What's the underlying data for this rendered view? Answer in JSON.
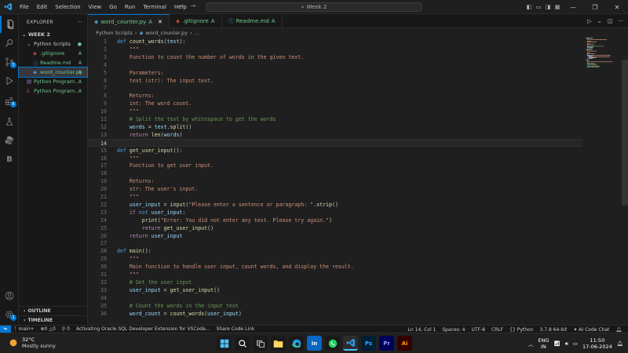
{
  "menu": [
    "File",
    "Edit",
    "Selection",
    "View",
    "Go",
    "Run",
    "Terminal",
    "Help"
  ],
  "search": {
    "text": "Week 2"
  },
  "explorer": {
    "header": "EXPLORER",
    "workspace": "WEEK 2",
    "items": [
      {
        "name": "Python Scripts",
        "status": "",
        "indent": 1,
        "kind": "folder"
      },
      {
        "name": ".gitignore",
        "status": "A",
        "indent": 2,
        "kind": "git"
      },
      {
        "name": "Readme.md",
        "status": "A",
        "indent": 2,
        "kind": "md"
      },
      {
        "name": "word_counter.py",
        "status": "A",
        "indent": 2,
        "kind": "py",
        "selected": true
      },
      {
        "name": "Python Program...",
        "status": "A",
        "indent": 1,
        "kind": "pdf"
      },
      {
        "name": "Python Program...",
        "status": "A",
        "indent": 1,
        "kind": "pdfr"
      }
    ],
    "outline": "OUTLINE",
    "timeline": "TIMELINE"
  },
  "tabs": [
    {
      "label": "word_counter.py",
      "status": "A",
      "active": true
    },
    {
      "label": ".gitignore",
      "status": "A",
      "active": false
    },
    {
      "label": "Readme.md",
      "status": "A",
      "active": false
    }
  ],
  "breadcrumb": {
    "folder": "Python Scripts",
    "file": "word_counter.py",
    "more": "..."
  },
  "code": [
    [
      [
        "kw",
        "def "
      ],
      [
        "fn",
        "count_words"
      ],
      [
        "code",
        "("
      ],
      [
        "var",
        "text"
      ],
      [
        "code",
        "):"
      ]
    ],
    [
      [
        "doc",
        "    \"\"\""
      ]
    ],
    [
      [
        "doc",
        "    Function to count the number of words in the given text."
      ]
    ],
    [
      [
        "doc",
        ""
      ]
    ],
    [
      [
        "doc",
        "    Parameters:"
      ]
    ],
    [
      [
        "doc",
        "    text (str): The input text."
      ]
    ],
    [
      [
        "doc",
        ""
      ]
    ],
    [
      [
        "doc",
        "    Returns:"
      ]
    ],
    [
      [
        "doc",
        "    int: The word count."
      ]
    ],
    [
      [
        "doc",
        "    \"\"\""
      ]
    ],
    [
      [
        "cm",
        "    # Split the text by whitespace to get the words"
      ]
    ],
    [
      [
        "var",
        "    words"
      ],
      [
        "code",
        " = "
      ],
      [
        "var",
        "text"
      ],
      [
        "code",
        "."
      ],
      [
        "fn",
        "split"
      ],
      [
        "code",
        "()"
      ]
    ],
    [
      [
        "kwf",
        "    return "
      ],
      [
        "bi",
        "len"
      ],
      [
        "code",
        "("
      ],
      [
        "var",
        "words"
      ],
      [
        "code",
        ")"
      ]
    ],
    [
      [
        "code",
        ""
      ]
    ],
    [
      [
        "kw",
        "def "
      ],
      [
        "fn",
        "get_user_input"
      ],
      [
        "code",
        "():"
      ]
    ],
    [
      [
        "doc",
        "    \"\"\""
      ]
    ],
    [
      [
        "doc",
        "    Function to get user input."
      ]
    ],
    [
      [
        "doc",
        ""
      ]
    ],
    [
      [
        "doc",
        "    Returns:"
      ]
    ],
    [
      [
        "doc",
        "    str: The user's input."
      ]
    ],
    [
      [
        "doc",
        "    \"\"\""
      ]
    ],
    [
      [
        "var",
        "    user_input"
      ],
      [
        "code",
        " = "
      ],
      [
        "bi",
        "input"
      ],
      [
        "code",
        "("
      ],
      [
        "str",
        "\"Please enter a sentence or paragraph: \""
      ],
      [
        "code",
        "."
      ],
      [
        "fn",
        "strip"
      ],
      [
        "code",
        "()"
      ]
    ],
    [
      [
        "kwf",
        "    if "
      ],
      [
        "kw",
        "not "
      ],
      [
        "var",
        "user_input"
      ],
      [
        "code",
        ":"
      ]
    ],
    [
      [
        "bi",
        "        print"
      ],
      [
        "code",
        "("
      ],
      [
        "str",
        "\"Error: You did not enter any text. Please try again.\""
      ],
      [
        "code",
        ")"
      ]
    ],
    [
      [
        "kwf",
        "        return "
      ],
      [
        "fn",
        "get_user_input"
      ],
      [
        "code",
        "()"
      ]
    ],
    [
      [
        "kwf",
        "    return "
      ],
      [
        "var",
        "user_input"
      ]
    ],
    [
      [
        "code",
        ""
      ]
    ],
    [
      [
        "kw",
        "def "
      ],
      [
        "fn",
        "main"
      ],
      [
        "code",
        "():"
      ]
    ],
    [
      [
        "doc",
        "    \"\"\""
      ]
    ],
    [
      [
        "doc",
        "    Main function to handle user input, count words, and display the result."
      ]
    ],
    [
      [
        "doc",
        "    \"\"\""
      ]
    ],
    [
      [
        "cm",
        "    # Get the user input"
      ]
    ],
    [
      [
        "var",
        "    user_input"
      ],
      [
        "code",
        " = "
      ],
      [
        "fn",
        "get_user_input"
      ],
      [
        "code",
        "()"
      ]
    ],
    [
      [
        "code",
        ""
      ]
    ],
    [
      [
        "cm",
        "    # Count the words in the input text"
      ]
    ],
    [
      [
        "var",
        "    word_count"
      ],
      [
        "code",
        " = "
      ],
      [
        "fn",
        "count_words"
      ],
      [
        "code",
        "("
      ],
      [
        "var",
        "user_input"
      ],
      [
        "code",
        ")"
      ]
    ]
  ],
  "current_line": 14,
  "status": {
    "branch": "main+",
    "errors": "0",
    "warnings": "0",
    "ports": "0",
    "activity": "Activating Oracle SQL Developer Extension for VSCode...",
    "share": "Share Code Link",
    "position": "Ln 14, Col 1",
    "spaces": "Spaces: 4",
    "encoding": "UTF-8",
    "eol": "CRLF",
    "language": "Python",
    "interpreter": "3.7.8 64-bit",
    "ai": "AI Code Chat"
  },
  "taskbar": {
    "temp": "32°C",
    "weather": "Mostly sunny",
    "lang1": "ENG",
    "lang2": "IN",
    "time": "11:50",
    "date": "17-06-2024",
    "apps": [
      {
        "icon": "windows-icon",
        "glyph": "",
        "color": "#1a1a1a"
      },
      {
        "icon": "search-icon",
        "glyph": "",
        "color": "#1a1a1a"
      },
      {
        "icon": "task-view-icon",
        "glyph": "",
        "color": "#1a1a1a"
      },
      {
        "icon": "file-explorer-icon",
        "glyph": "",
        "color": "#1a1a1a"
      },
      {
        "icon": "edge-icon",
        "glyph": "",
        "color": "#1a1a1a"
      },
      {
        "icon": "linkedin-icon",
        "glyph": "in",
        "color": "#0a66c2"
      },
      {
        "icon": "whatsapp-icon",
        "glyph": "",
        "color": "#1a1a1a"
      },
      {
        "icon": "vscode-icon",
        "glyph": "",
        "color": "#2d2d2d"
      },
      {
        "icon": "photoshop-icon",
        "glyph": "Ps",
        "color": "#001e36"
      },
      {
        "icon": "premiere-icon",
        "glyph": "Pr",
        "color": "#00005b"
      },
      {
        "icon": "illustrator-icon",
        "glyph": "Ai",
        "color": "#330000"
      }
    ]
  },
  "colors": {
    "accent": "#0078d4",
    "git_added": "#73c991"
  }
}
